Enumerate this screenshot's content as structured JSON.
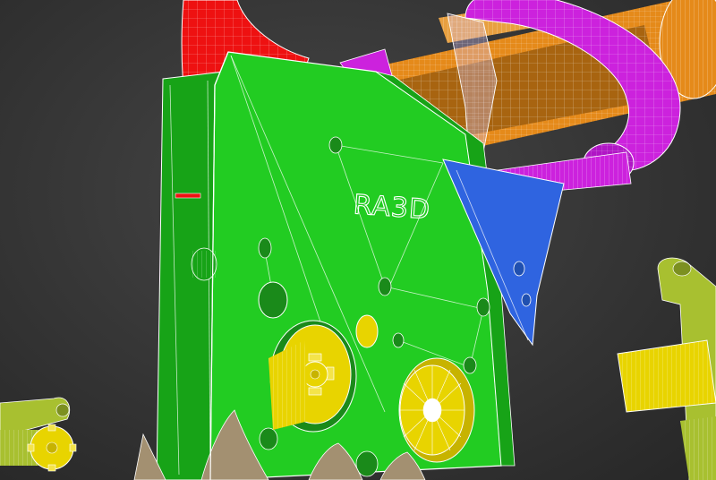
{
  "scene": {
    "embossed_label": "RA3D",
    "colors": {
      "background": "#3a3a3a",
      "plate_green": "#22cc22",
      "plate_green_dark": "#17a317",
      "red_arm": "#ee1111",
      "purple_ring": "#cc22dd",
      "orange_shaft": "#e58a1a",
      "brown_core": "#a86410",
      "blue_bracket": "#2f64e0",
      "gear_yellow": "#e8d400",
      "gear_olive": "#a8c030",
      "base_tan": "#a39071",
      "wire": "#ffffff"
    },
    "icons": [
      "spur-gear",
      "wheel-spokes",
      "rack-gear",
      "wireframe-mesh"
    ]
  }
}
